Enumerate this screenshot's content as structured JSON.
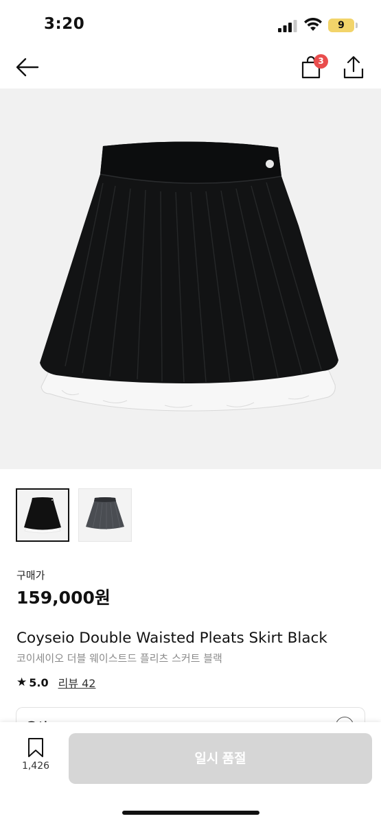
{
  "status_bar": {
    "time": "3:20",
    "battery": "9"
  },
  "header": {
    "cart_count": "3"
  },
  "product": {
    "price_label": "구매가",
    "price": "159,000원",
    "name_en": "Coyseio Double Waisted Pleats Skirt Black",
    "name_ko": "코이세이오 더블 웨이스트드 플리츠 스커트 블랙",
    "rating": "5.0",
    "reviews": "리뷰 42",
    "images": [
      {
        "color": "black",
        "selected": true
      },
      {
        "color": "gray",
        "selected": false
      }
    ]
  },
  "option": {
    "label": "옵션"
  },
  "bottom": {
    "wish_count": "1,426",
    "buy_label": "일시 품절"
  },
  "colors": {
    "badge": "#e94d4d",
    "button_disabled": "#d6d6d6",
    "hero_bg": "#f1f1f1"
  },
  "icons": [
    "back-arrow-icon",
    "cart-icon",
    "share-icon",
    "star-icon",
    "bookmark-icon",
    "chevron-icon"
  ]
}
